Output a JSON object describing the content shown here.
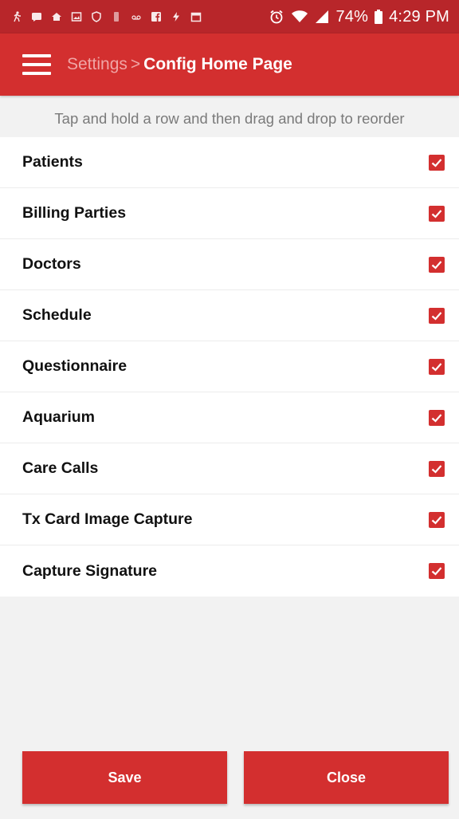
{
  "status_bar": {
    "battery": "74%",
    "time": "4:29 PM",
    "left_icons": [
      "running-icon",
      "message-icon",
      "home-icon",
      "image-icon",
      "shield-icon",
      "phone-icon",
      "voicemail-icon",
      "facebook-icon",
      "bolt-icon",
      "calendar-icon"
    ],
    "right_icons": [
      "alarm-icon",
      "wifi-icon",
      "signal-icon",
      "battery-icon"
    ]
  },
  "app_bar": {
    "breadcrumb_parent": "Settings",
    "breadcrumb_separator": ">",
    "breadcrumb_current": "Config Home Page",
    "menu_icon": "hamburger-menu-icon"
  },
  "hint": "Tap and hold a row and then drag and drop to reorder",
  "rows": [
    {
      "label": "Patients",
      "checked": true
    },
    {
      "label": "Billing Parties",
      "checked": true
    },
    {
      "label": "Doctors",
      "checked": true
    },
    {
      "label": "Schedule",
      "checked": true
    },
    {
      "label": "Questionnaire",
      "checked": true
    },
    {
      "label": "Aquarium",
      "checked": true
    },
    {
      "label": "Care Calls",
      "checked": true
    },
    {
      "label": "Tx Card Image Capture",
      "checked": true
    },
    {
      "label": "Capture Signature",
      "checked": true
    }
  ],
  "buttons": {
    "save_label": "Save",
    "close_label": "Close"
  },
  "colors": {
    "status_bar": "#b8262a",
    "primary": "#d32f2f",
    "breadcrumb_parent": "#f0a5a5",
    "background": "#f2f2f2"
  }
}
